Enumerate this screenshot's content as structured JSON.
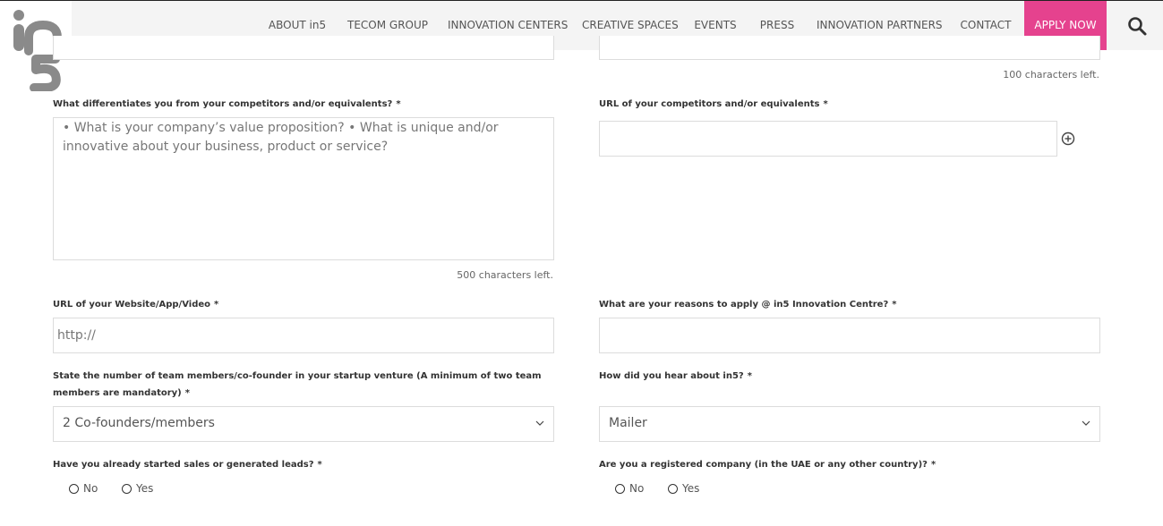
{
  "header": {
    "nav": [
      "ABOUT in5",
      "TECOM GROUP",
      "INNOVATION CENTERS",
      "CREATIVE SPACES",
      "EVENTS",
      "PRESS",
      "INNOVATION PARTNERS",
      "CONTACT"
    ],
    "apply_label": "APPLY NOW",
    "logo_text": "in5"
  },
  "form": {
    "top_right_counter": "100 characters left.",
    "differentiates": {
      "label": "What differentiates you from your competitors and/or equivalents?",
      "placeholder": "• What is your company’s value proposition? • What is unique and/or innovative about your business, product or service?",
      "counter": "500 characters left."
    },
    "competitor_url": {
      "label": "URL of your competitors and/or equivalents"
    },
    "website_url": {
      "label": "URL of your Website/App/Video",
      "placeholder": "http://"
    },
    "reasons": {
      "label": "What are your reasons to apply @ in5 Innovation Centre?"
    },
    "team": {
      "label": "State the number of team members/co-founder in your startup venture (A minimum of two team members are mandatory)",
      "value": "2 Co-founders/members"
    },
    "hear": {
      "label": "How did you hear about in5?",
      "value": "Mailer"
    },
    "sales": {
      "label": "Have you already started sales or generated leads?",
      "options": [
        "No",
        "Yes"
      ]
    },
    "registered": {
      "label": "Are you a registered company (in the UAE or any other country)?",
      "options": [
        "No",
        "Yes"
      ]
    },
    "required_mark": "*"
  },
  "colors": {
    "accent": "#e5428e",
    "header_bg": "#f4f4f4",
    "border": "#dcdcdc"
  }
}
